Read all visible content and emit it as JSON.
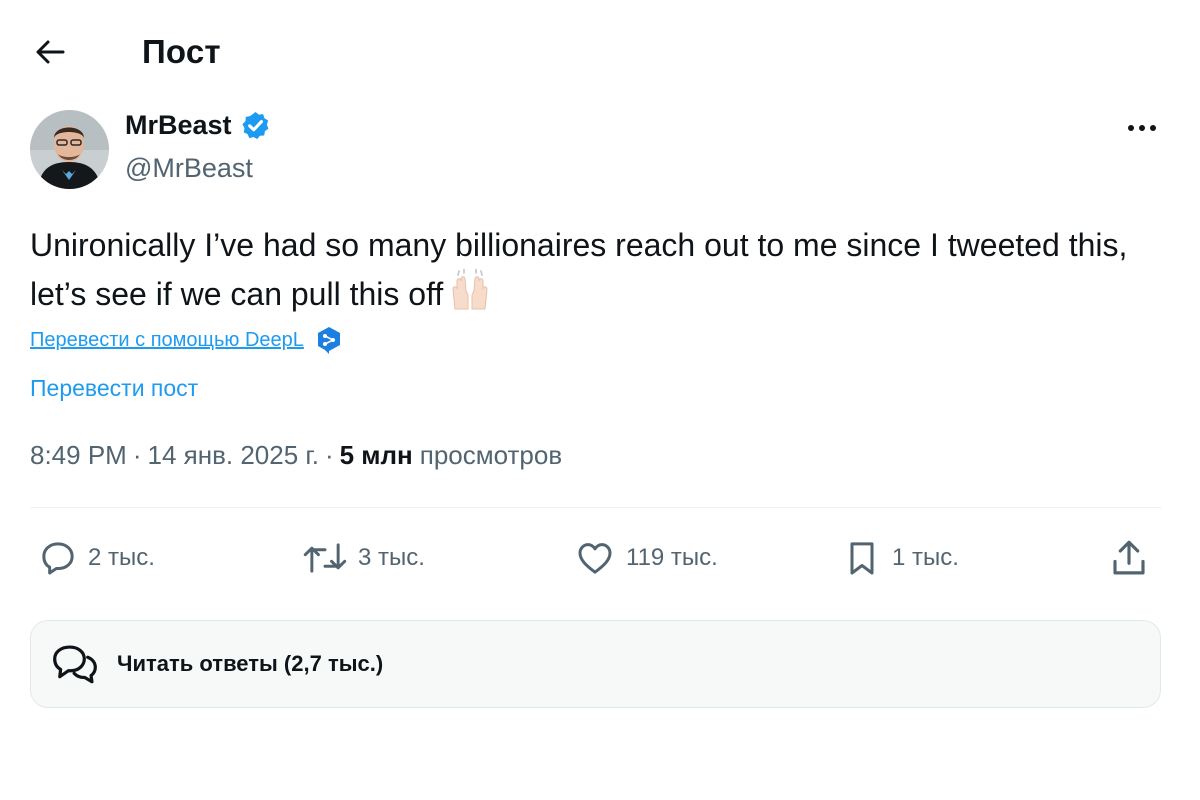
{
  "header": {
    "back_icon": "arrow-left-icon",
    "title": "Пост"
  },
  "author": {
    "name": "MrBeast",
    "handle": "@MrBeast",
    "verified": true,
    "verified_color": "#1d9bf0"
  },
  "post": {
    "text": "Unironically I’ve had so many billionaires reach out to me since I tweeted this, let’s see if we can pull this off",
    "emoji": "raising-hands-emoji"
  },
  "translation": {
    "deepl_link": "Перевести с помощью DeepL",
    "translate_post": "Перевести пост"
  },
  "meta": {
    "time": "8:49 PM",
    "date": "14 янв. 2025 г.",
    "separator": "·",
    "views_count": "5 млн",
    "views_label": "просмотров"
  },
  "actions": {
    "replies": "2 тыс.",
    "reposts": "3 тыс.",
    "likes": "119 тыс.",
    "bookmarks": "1 тыс."
  },
  "replies_card": {
    "label": "Читать ответы (2,7 тыс.)"
  },
  "colors": {
    "accent": "#1d9bf0",
    "text_primary": "#0f1419",
    "text_secondary": "#536471"
  }
}
